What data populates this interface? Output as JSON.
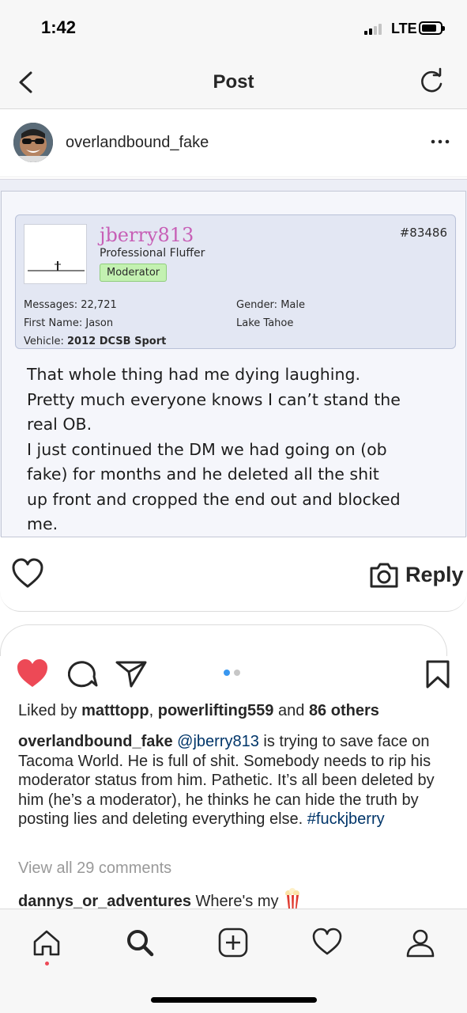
{
  "status_bar": {
    "time": "1:42",
    "network": "LTE"
  },
  "header": {
    "title": "Post"
  },
  "post": {
    "author": "overlandbound_fake"
  },
  "forum_post": {
    "username": "jberry813",
    "user_title": "Professional Fluffer",
    "badge": "Moderator",
    "post_number": "#83486",
    "messages": "Messages: 22,721",
    "first_name": "First Name: Jason",
    "vehicle_label": "Vehicle:",
    "vehicle_value": "2012 DCSB Sport",
    "gender": "Gender: Male",
    "location": "Lake Tahoe",
    "body_lines": [
      "That whole thing had me dying laughing.",
      "Pretty much everyone knows I can’t stand the",
      "real OB.",
      "I just continued the DM we had going on (ob",
      "fake) for months and he deleted all the shit",
      "up front and cropped the end out and blocked",
      "me."
    ]
  },
  "dm_overlay": {
    "reply_label": "Reply"
  },
  "likes": {
    "prefix": "Liked by",
    "user1": "matttopp",
    "separator": ",",
    "user2": "powerlifting559",
    "conjunction": "and",
    "others": "86 others"
  },
  "caption": {
    "author": "overlandbound_fake",
    "mention": "@jberry813",
    "text": "is trying to save face on Tacoma World. He is full of shit. Somebody needs to rip his moderator status from him. Pathetic. It’s all been deleted by him (he’s a moderator), he thinks he can hide the truth by posting lies and deleting everything else.",
    "hashtag": "#fuckjberry"
  },
  "comments": {
    "view_all": "View all 29 comments",
    "first_user": "dannys_or_adventures",
    "first_text": "Where's my"
  },
  "carousel": {
    "count": 2,
    "active_index": 0
  },
  "colors": {
    "like_red": "#ed4956",
    "link_blue": "#003569",
    "dot_active": "#3897f0",
    "forum_username": "#c75fb6",
    "moderator_badge": "#c3f1b1"
  }
}
